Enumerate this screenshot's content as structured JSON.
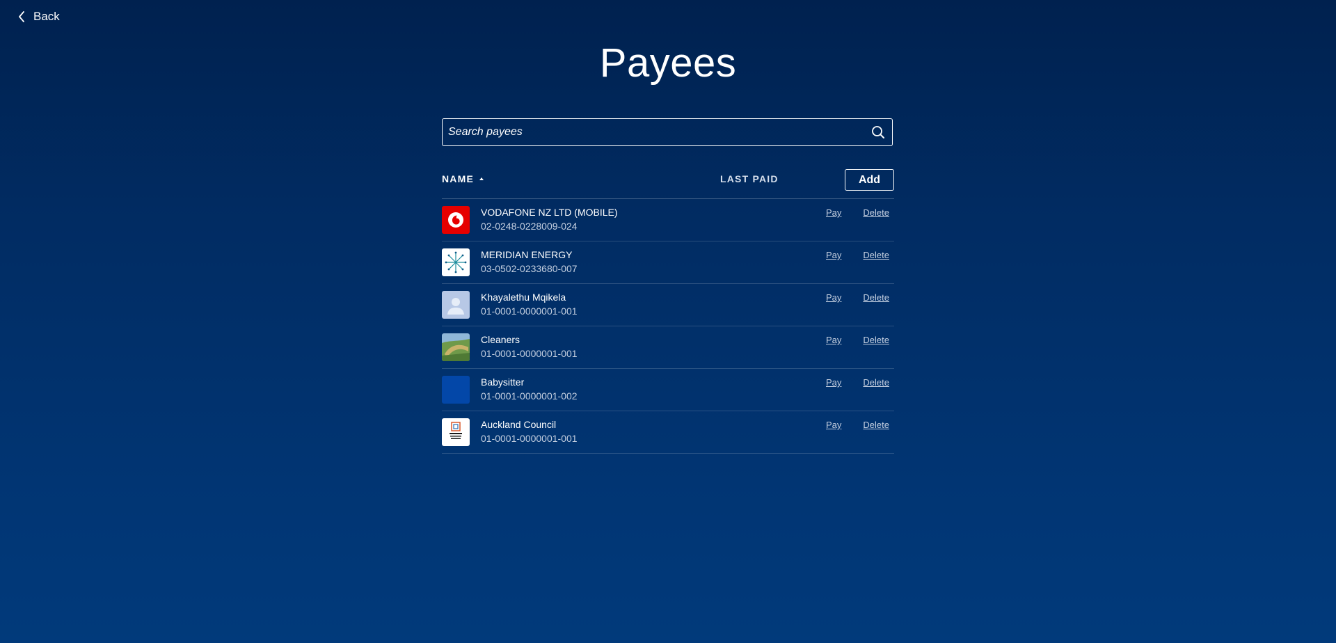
{
  "nav": {
    "back_label": "Back"
  },
  "page": {
    "title": "Payees"
  },
  "search": {
    "placeholder": "Search payees",
    "value": ""
  },
  "table": {
    "columns": {
      "name": "NAME",
      "last_paid": "LAST PAID"
    },
    "sort": {
      "column": "NAME",
      "direction": "ascending"
    },
    "add_label": "Add",
    "rows": [
      {
        "name": "VODAFONE NZ LTD (MOBILE)",
        "account": "02-0248-0228009-024",
        "pay_label": "Pay",
        "delete_label": "Delete",
        "icon": "vodafone-logo-icon"
      },
      {
        "name": "MERIDIAN ENERGY",
        "account": "03-0502-0233680-007",
        "pay_label": "Pay",
        "delete_label": "Delete",
        "icon": "meridian-energy-logo-icon"
      },
      {
        "name": "Khayalethu Mqikela",
        "account": "01-0001-0000001-001",
        "pay_label": "Pay",
        "delete_label": "Delete",
        "icon": "person-silhouette-icon"
      },
      {
        "name": "Cleaners",
        "account": "01-0001-0000001-001",
        "pay_label": "Pay",
        "delete_label": "Delete",
        "icon": "landscape-photo-icon"
      },
      {
        "name": "Babysitter",
        "account": "01-0001-0000001-002",
        "pay_label": "Pay",
        "delete_label": "Delete",
        "icon": "blue-square-icon"
      },
      {
        "name": "Auckland Council",
        "account": "01-0001-0000001-001",
        "pay_label": "Pay",
        "delete_label": "Delete",
        "icon": "auckland-council-logo-icon"
      }
    ]
  },
  "colors": {
    "background_top": "#00214f",
    "background_bottom": "#013a7b",
    "text": "#ffffff",
    "muted_text": "#c4cfe0",
    "vodafone_red": "#e60000",
    "babysitter_blue": "#0347a8"
  }
}
